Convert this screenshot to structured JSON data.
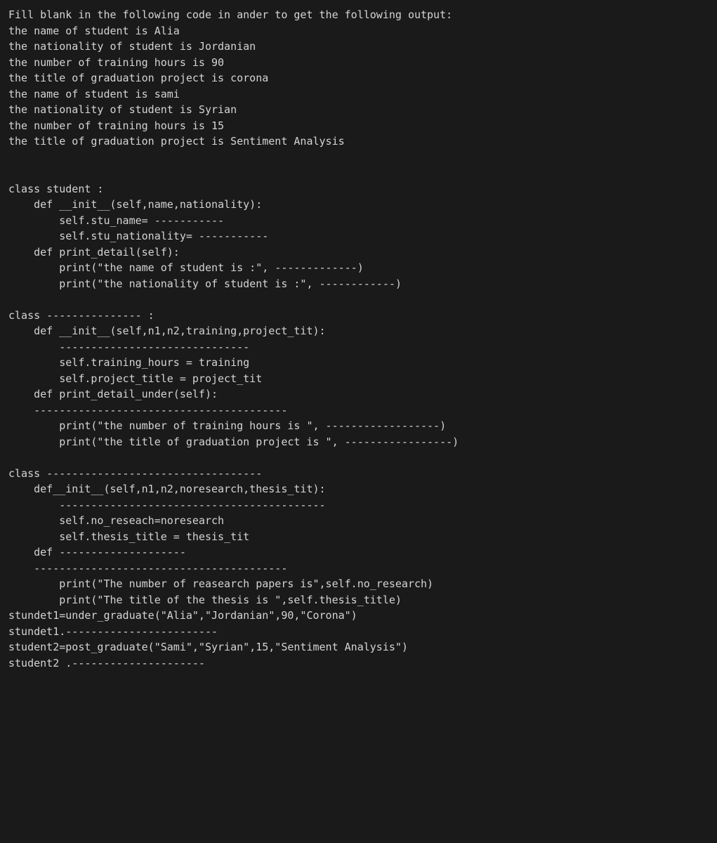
{
  "content": {
    "lines": [
      "Fill blank in the following code in ander to get the following output:",
      "the name of student is Alia",
      "the nationality of student is Jordanian",
      "the number of training hours is 90",
      "the title of graduation project is corona",
      "the name of student is sami",
      "the nationality of student is Syrian",
      "the number of training hours is 15",
      "the title of graduation project is Sentiment Analysis",
      "",
      "",
      "class student :",
      "    def __init__(self,name,nationality):",
      "        self.stu_name= -----------",
      "        self.stu_nationality= -----------",
      "    def print_detail(self):",
      "        print(\"the name of student is :\", -------------)",
      "        print(\"the nationality of student is :\", ------------)",
      "",
      "class --------------- :",
      "    def __init__(self,n1,n2,training,project_tit):",
      "        ------------------------------",
      "        self.training_hours = training",
      "        self.project_title = project_tit",
      "    def print_detail_under(self):",
      "    ----------------------------------------",
      "        print(\"the number of training hours is \", ------------------)",
      "        print(\"the title of graduation project is \", -----------------)",
      "",
      "class ----------------------------------",
      "    def__init__(self,n1,n2,noresearch,thesis_tit):",
      "        ------------------------------------------",
      "        self.no_reseach=noresearch",
      "        self.thesis_title = thesis_tit",
      "    def --------------------",
      "    ----------------------------------------",
      "        print(\"The number of reasearch papers is\",self.no_research)",
      "        print(\"The title of the thesis is \",self.thesis_title)",
      "stundet1=under_graduate(\"Alia\",\"Jordanian\",90,\"Corona\")",
      "stundet1.------------------------",
      "student2=post_graduate(\"Sami\",\"Syrian\",15,\"Sentiment Analysis\")",
      "student2 .---------------------"
    ]
  }
}
